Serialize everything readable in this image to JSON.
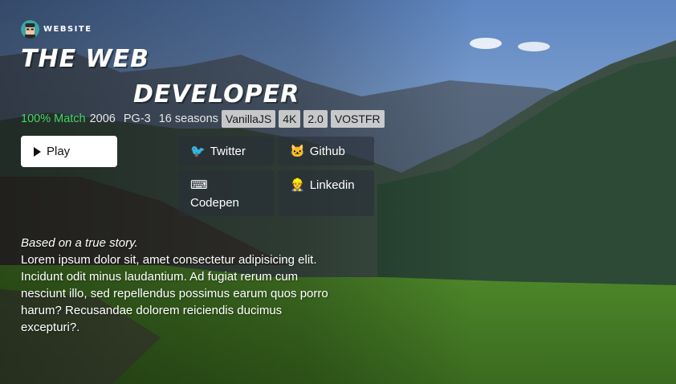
{
  "brand": {
    "label": "WEBSITE",
    "avatar_icon": "developer-avatar-icon"
  },
  "hero": {
    "title_line1": "THE WEB",
    "title_line2": "DEVELOPER"
  },
  "meta": {
    "match": "100% Match",
    "year": "2006",
    "rating": "PG-3",
    "seasons": "16 seasons",
    "badges": [
      "VanillaJS",
      "4K",
      "2.0",
      "VOSTFR"
    ],
    "match_color": "#46d369"
  },
  "play_button": {
    "label": "Play",
    "icon": "play-icon"
  },
  "social": [
    {
      "label": "Twitter",
      "icon": "bird-icon",
      "glyph": "🐦"
    },
    {
      "label": "Github",
      "icon": "cat-icon",
      "glyph": "🐱"
    },
    {
      "label": "Codepen",
      "icon": "keyboard-icon",
      "glyph": "⌨"
    },
    {
      "label": "Linkedin",
      "icon": "worker-icon",
      "glyph": "👷"
    }
  ],
  "description": {
    "tagline": "Based on a true story.",
    "body": "Lorem ipsum dolor sit, amet consectetur adipisicing elit. Incidunt odit minus laudantium. Ad fugiat rerum cum nesciunt illo, sed repellendus possimus earum quos porro harum? Recusandae dolorem reiciendis ducimus excepturi?."
  }
}
